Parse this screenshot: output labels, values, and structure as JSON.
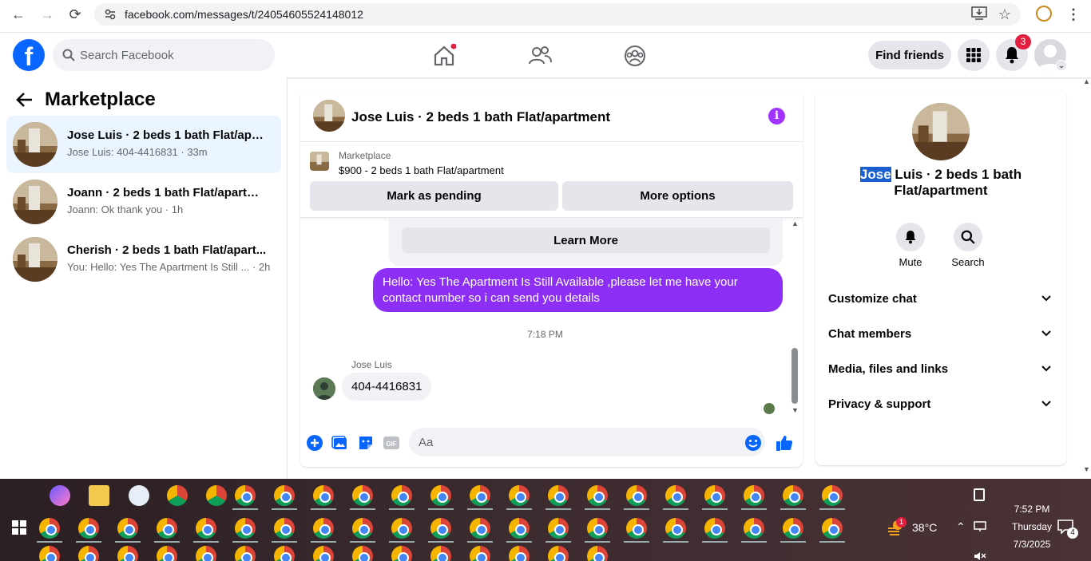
{
  "browser": {
    "url": "facebook.com/messages/t/24054605524148012"
  },
  "header": {
    "search_placeholder": "Search Facebook",
    "find_friends_label": "Find friends",
    "notification_count": "3"
  },
  "left_pane": {
    "title": "Marketplace",
    "conversations": [
      {
        "name": "Jose Luis · 2 beds 1 bath Flat/apart...",
        "preview": "Jose Luis: 404-4416831 · 33m",
        "active": true
      },
      {
        "name": "Joann · 2 beds 1 bath Flat/apartme...",
        "preview": "Joann: Ok thank you · 1h",
        "active": false
      },
      {
        "name": "Cherish · 2 beds 1 bath Flat/apart...",
        "preview": "You: Hello: Yes The Apartment Is Still ... · 2h",
        "active": false
      }
    ]
  },
  "chat": {
    "title": "Jose Luis · 2 beds 1 bath Flat/apartment",
    "listing_source": "Marketplace",
    "listing_price_title": "$900 - 2 beds 1 bath Flat/apartment",
    "mark_pending_label": "Mark as pending",
    "more_options_label": "More options",
    "learn_more_label": "Learn More",
    "outgoing_message": "Hello: Yes The Apartment Is Still Available ,please let me have your contact number so i can send you details",
    "timestamp": "7:18 PM",
    "sender_name": "Jose Luis",
    "incoming_message": "404-4416831",
    "input_placeholder": "Aa"
  },
  "right_pane": {
    "name_selected": "Jose",
    "name_rest": " Luis · 2 beds 1 bath Flat/apartment",
    "mute_label": "Mute",
    "search_label": "Search",
    "sections": [
      "Customize chat",
      "Chat members",
      "Media, files and links",
      "Privacy & support"
    ]
  },
  "taskbar": {
    "weather_badge": "1",
    "temperature": "38°C",
    "time": "7:52 PM",
    "day": "Thursday",
    "date": "7/3/2025",
    "notification_count": "4"
  },
  "colors": {
    "fb_blue": "#0866ff",
    "outgoing_bubble": "#8d2ef5",
    "active_conversation": "#ebf5ff"
  }
}
